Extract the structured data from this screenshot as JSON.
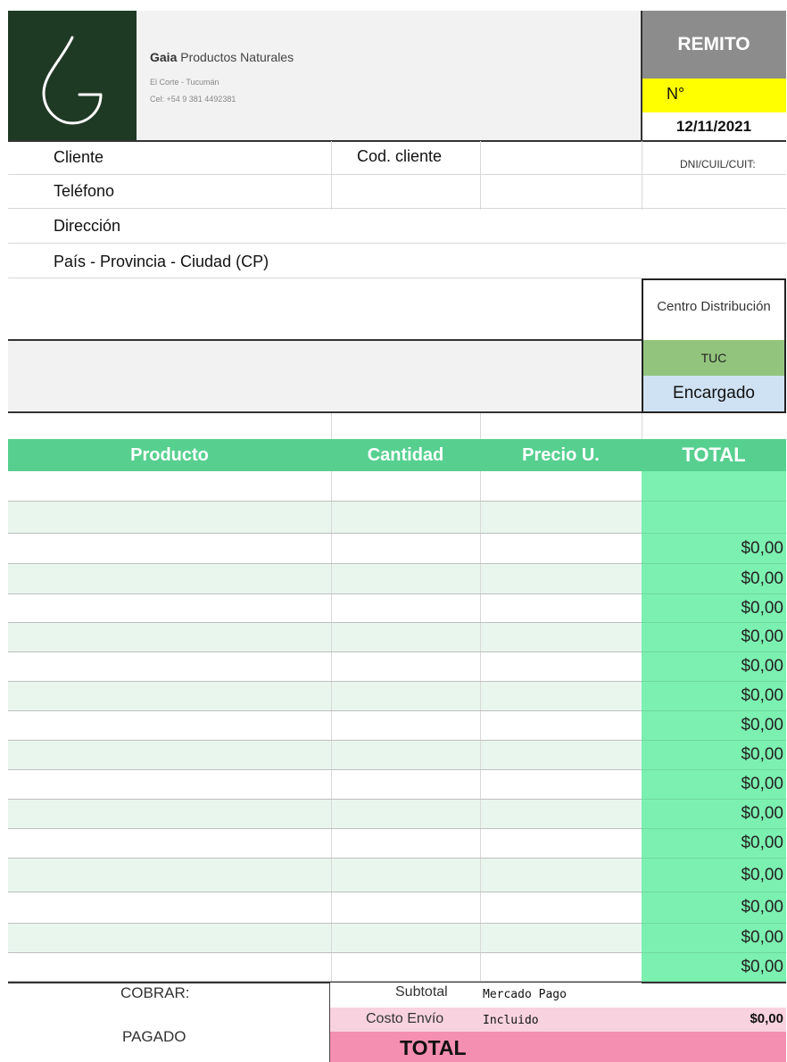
{
  "company": {
    "name_bold": "Gaia",
    "name_rest": " Productos Naturales",
    "location": "El Corte - Tucumán",
    "phone": "Cel: +54 9 381 4492381"
  },
  "doc": {
    "title": "REMITO",
    "number_label": "N°",
    "date": "12/11/2021"
  },
  "client": {
    "cliente": "Cliente",
    "cod_cliente": "Cod. cliente",
    "dni": "DNI/CUIL/CUIT:",
    "telefono": "Teléfono",
    "direccion": "Dirección",
    "ubicacion": "País - Provincia - Ciudad (CP)"
  },
  "distribution": {
    "label": "Centro Distribución",
    "code": "TUC",
    "encargado": "Encargado"
  },
  "table": {
    "headers": [
      "Producto",
      "Cantidad",
      "Precio U.",
      "TOTAL"
    ],
    "totals": [
      "",
      "",
      "$0,00",
      "$0,00",
      "$0,00",
      "$0,00",
      "$0,00",
      "$0,00",
      "$0,00",
      "$0,00",
      "$0,00",
      "$0,00",
      "$0,00",
      "$0,00",
      "$0,00",
      "$0,00",
      "$0,00"
    ]
  },
  "footer": {
    "cobrar": "COBRAR:",
    "pagado": "PAGADO",
    "subtotal": "Subtotal",
    "payment": "Mercado Pago",
    "costo_envio": "Costo Envío",
    "envio_status": "Incluido",
    "envio_amount": "$0,00",
    "total": "TOTAL"
  },
  "colors": {
    "header_green": "#57d08f",
    "total_green": "#7cf0b0",
    "row_alt": "#e8f6ee",
    "yellow": "#ffff00",
    "pink": "#f48fb1",
    "light_pink": "#f8d3df"
  }
}
